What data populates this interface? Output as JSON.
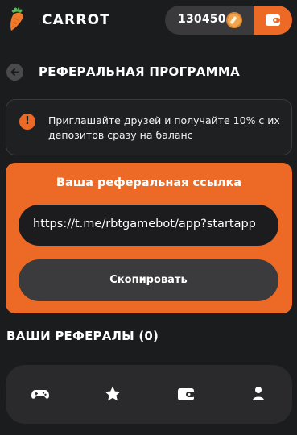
{
  "header": {
    "brand": "CARROT",
    "balance": "130450",
    "icons": {
      "logo": "carrot-logo",
      "coin": "coin-icon",
      "wallet": "wallet-icon"
    },
    "colors": {
      "accent": "#ec6a25",
      "background": "#1b1c1e"
    }
  },
  "page": {
    "title": "РЕФЕРАЛЬНАЯ ПРОГРАММА",
    "back_icon": "arrow-left-icon"
  },
  "info": {
    "icon": "exclamation-icon",
    "text": "Приглашайте друзей и получайте 10% с их депозитов сразу на баланс"
  },
  "referral": {
    "title": "Ваша реферальная ссылка",
    "link": "https://t.me/rbtgamebot/app?startapp",
    "copy_label": "Скопировать"
  },
  "referrals": {
    "heading": "ВАШИ РЕФЕРАЛЫ (0)"
  },
  "nav": {
    "items": [
      {
        "icon": "gamepad-icon"
      },
      {
        "icon": "star-icon"
      },
      {
        "icon": "wallet-icon"
      },
      {
        "icon": "user-icon"
      }
    ]
  }
}
